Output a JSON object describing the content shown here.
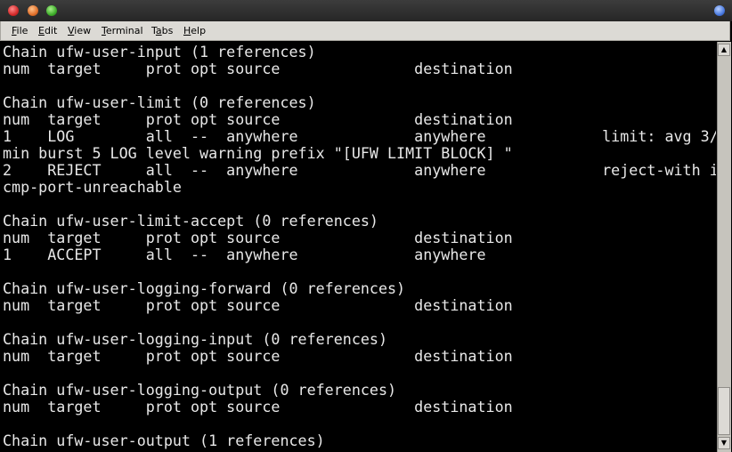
{
  "window": {
    "buttons": [
      "close",
      "minimize",
      "maximize"
    ]
  },
  "menu": {
    "items": [
      {
        "label": "File",
        "mnemonic": "F",
        "rest": "ile"
      },
      {
        "label": "Edit",
        "mnemonic": "E",
        "rest": "dit"
      },
      {
        "label": "View",
        "mnemonic": "V",
        "rest": "iew"
      },
      {
        "label": "Terminal",
        "mnemonic": "T",
        "rest": "erminal"
      },
      {
        "label": "Tabs",
        "mnemonic": "a",
        "pre": "T",
        "rest": "bs"
      },
      {
        "label": "Help",
        "mnemonic": "H",
        "rest": "elp"
      }
    ]
  },
  "terminal": {
    "lines": [
      "Chain ufw-user-input (1 references)",
      "num  target     prot opt source               destination",
      "",
      "Chain ufw-user-limit (0 references)",
      "num  target     prot opt source               destination",
      "1    LOG        all  --  anywhere             anywhere             limit: avg 3/",
      "min burst 5 LOG level warning prefix \"[UFW LIMIT BLOCK] \"",
      "2    REJECT     all  --  anywhere             anywhere             reject-with i",
      "cmp-port-unreachable",
      "",
      "Chain ufw-user-limit-accept (0 references)",
      "num  target     prot opt source               destination",
      "1    ACCEPT     all  --  anywhere             anywhere",
      "",
      "Chain ufw-user-logging-forward (0 references)",
      "num  target     prot opt source               destination",
      "",
      "Chain ufw-user-logging-input (0 references)",
      "num  target     prot opt source               destination",
      "",
      "Chain ufw-user-logging-output (0 references)",
      "num  target     prot opt source               destination",
      "",
      "Chain ufw-user-output (1 references)"
    ]
  },
  "scrollbar": {
    "up_glyph": "▲",
    "down_glyph": "▼",
    "position_fraction": 0.9
  }
}
